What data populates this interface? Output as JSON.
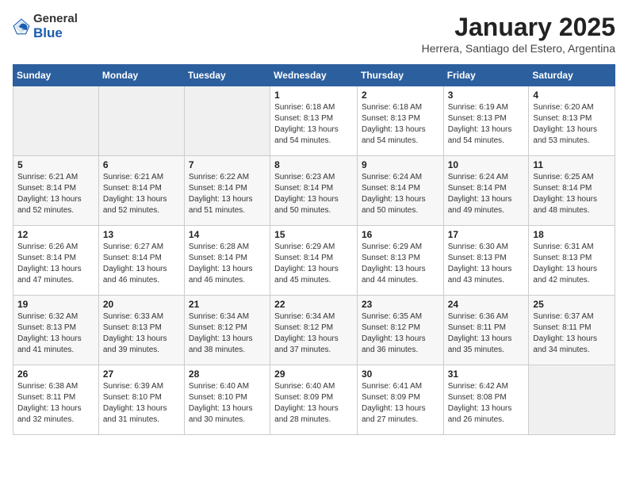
{
  "header": {
    "logo_general": "General",
    "logo_blue": "Blue",
    "month": "January 2025",
    "location": "Herrera, Santiago del Estero, Argentina"
  },
  "weekdays": [
    "Sunday",
    "Monday",
    "Tuesday",
    "Wednesday",
    "Thursday",
    "Friday",
    "Saturday"
  ],
  "weeks": [
    [
      {
        "day": "",
        "info": ""
      },
      {
        "day": "",
        "info": ""
      },
      {
        "day": "",
        "info": ""
      },
      {
        "day": "1",
        "info": "Sunrise: 6:18 AM\nSunset: 8:13 PM\nDaylight: 13 hours\nand 54 minutes."
      },
      {
        "day": "2",
        "info": "Sunrise: 6:18 AM\nSunset: 8:13 PM\nDaylight: 13 hours\nand 54 minutes."
      },
      {
        "day": "3",
        "info": "Sunrise: 6:19 AM\nSunset: 8:13 PM\nDaylight: 13 hours\nand 54 minutes."
      },
      {
        "day": "4",
        "info": "Sunrise: 6:20 AM\nSunset: 8:13 PM\nDaylight: 13 hours\nand 53 minutes."
      }
    ],
    [
      {
        "day": "5",
        "info": "Sunrise: 6:21 AM\nSunset: 8:14 PM\nDaylight: 13 hours\nand 52 minutes."
      },
      {
        "day": "6",
        "info": "Sunrise: 6:21 AM\nSunset: 8:14 PM\nDaylight: 13 hours\nand 52 minutes."
      },
      {
        "day": "7",
        "info": "Sunrise: 6:22 AM\nSunset: 8:14 PM\nDaylight: 13 hours\nand 51 minutes."
      },
      {
        "day": "8",
        "info": "Sunrise: 6:23 AM\nSunset: 8:14 PM\nDaylight: 13 hours\nand 50 minutes."
      },
      {
        "day": "9",
        "info": "Sunrise: 6:24 AM\nSunset: 8:14 PM\nDaylight: 13 hours\nand 50 minutes."
      },
      {
        "day": "10",
        "info": "Sunrise: 6:24 AM\nSunset: 8:14 PM\nDaylight: 13 hours\nand 49 minutes."
      },
      {
        "day": "11",
        "info": "Sunrise: 6:25 AM\nSunset: 8:14 PM\nDaylight: 13 hours\nand 48 minutes."
      }
    ],
    [
      {
        "day": "12",
        "info": "Sunrise: 6:26 AM\nSunset: 8:14 PM\nDaylight: 13 hours\nand 47 minutes."
      },
      {
        "day": "13",
        "info": "Sunrise: 6:27 AM\nSunset: 8:14 PM\nDaylight: 13 hours\nand 46 minutes."
      },
      {
        "day": "14",
        "info": "Sunrise: 6:28 AM\nSunset: 8:14 PM\nDaylight: 13 hours\nand 46 minutes."
      },
      {
        "day": "15",
        "info": "Sunrise: 6:29 AM\nSunset: 8:14 PM\nDaylight: 13 hours\nand 45 minutes."
      },
      {
        "day": "16",
        "info": "Sunrise: 6:29 AM\nSunset: 8:13 PM\nDaylight: 13 hours\nand 44 minutes."
      },
      {
        "day": "17",
        "info": "Sunrise: 6:30 AM\nSunset: 8:13 PM\nDaylight: 13 hours\nand 43 minutes."
      },
      {
        "day": "18",
        "info": "Sunrise: 6:31 AM\nSunset: 8:13 PM\nDaylight: 13 hours\nand 42 minutes."
      }
    ],
    [
      {
        "day": "19",
        "info": "Sunrise: 6:32 AM\nSunset: 8:13 PM\nDaylight: 13 hours\nand 41 minutes."
      },
      {
        "day": "20",
        "info": "Sunrise: 6:33 AM\nSunset: 8:13 PM\nDaylight: 13 hours\nand 39 minutes."
      },
      {
        "day": "21",
        "info": "Sunrise: 6:34 AM\nSunset: 8:12 PM\nDaylight: 13 hours\nand 38 minutes."
      },
      {
        "day": "22",
        "info": "Sunrise: 6:34 AM\nSunset: 8:12 PM\nDaylight: 13 hours\nand 37 minutes."
      },
      {
        "day": "23",
        "info": "Sunrise: 6:35 AM\nSunset: 8:12 PM\nDaylight: 13 hours\nand 36 minutes."
      },
      {
        "day": "24",
        "info": "Sunrise: 6:36 AM\nSunset: 8:11 PM\nDaylight: 13 hours\nand 35 minutes."
      },
      {
        "day": "25",
        "info": "Sunrise: 6:37 AM\nSunset: 8:11 PM\nDaylight: 13 hours\nand 34 minutes."
      }
    ],
    [
      {
        "day": "26",
        "info": "Sunrise: 6:38 AM\nSunset: 8:11 PM\nDaylight: 13 hours\nand 32 minutes."
      },
      {
        "day": "27",
        "info": "Sunrise: 6:39 AM\nSunset: 8:10 PM\nDaylight: 13 hours\nand 31 minutes."
      },
      {
        "day": "28",
        "info": "Sunrise: 6:40 AM\nSunset: 8:10 PM\nDaylight: 13 hours\nand 30 minutes."
      },
      {
        "day": "29",
        "info": "Sunrise: 6:40 AM\nSunset: 8:09 PM\nDaylight: 13 hours\nand 28 minutes."
      },
      {
        "day": "30",
        "info": "Sunrise: 6:41 AM\nSunset: 8:09 PM\nDaylight: 13 hours\nand 27 minutes."
      },
      {
        "day": "31",
        "info": "Sunrise: 6:42 AM\nSunset: 8:08 PM\nDaylight: 13 hours\nand 26 minutes."
      },
      {
        "day": "",
        "info": ""
      }
    ]
  ]
}
